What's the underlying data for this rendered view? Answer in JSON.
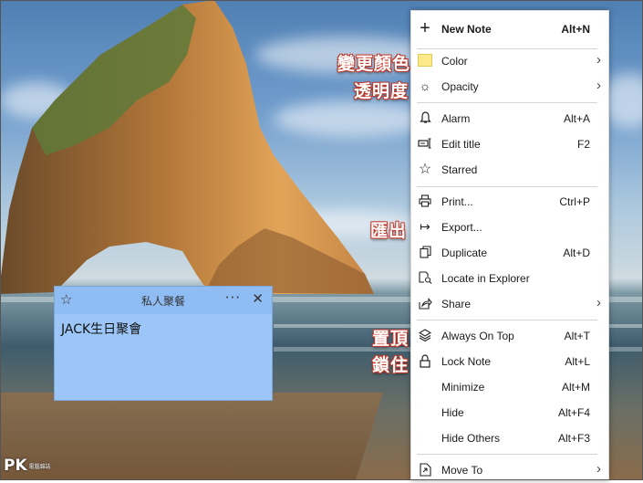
{
  "note": {
    "title": "私人聚餐",
    "body": "JACK生日聚會",
    "menu_glyph": "···",
    "close_glyph": "✕",
    "star_glyph": "☆"
  },
  "annotations": {
    "color": "變更顏色",
    "opacity": "透明度",
    "export": "匯出",
    "on_top": "置頂",
    "lock": "鎖住"
  },
  "watermark": {
    "brand": "PK",
    "tagline": "電腦雜誌"
  },
  "menu": {
    "items": [
      {
        "id": "new-note",
        "label": "New Note",
        "shortcut": "Alt+N",
        "icon": "plus-icon",
        "glyph": "+"
      },
      {
        "id": "color",
        "label": "Color",
        "shortcut": "",
        "icon": "color-swatch-icon",
        "glyph": "",
        "submenu": "›"
      },
      {
        "id": "opacity",
        "label": "Opacity",
        "shortcut": "",
        "icon": "sun-icon",
        "glyph": "☼",
        "submenu": "›"
      },
      {
        "id": "alarm",
        "label": "Alarm",
        "shortcut": "Alt+A",
        "icon": "bell-icon",
        "glyph": "🔔"
      },
      {
        "id": "edit-title",
        "label": "Edit title",
        "shortcut": "F2",
        "icon": "rename-icon",
        "glyph": "✎"
      },
      {
        "id": "starred",
        "label": "Starred",
        "shortcut": "",
        "icon": "star-icon",
        "glyph": "☆"
      },
      {
        "id": "print",
        "label": "Print...",
        "shortcut": "Ctrl+P",
        "icon": "printer-icon",
        "glyph": "⎙"
      },
      {
        "id": "export",
        "label": "Export...",
        "shortcut": "",
        "icon": "export-arrow-icon",
        "glyph": "↦"
      },
      {
        "id": "duplicate",
        "label": "Duplicate",
        "shortcut": "Alt+D",
        "icon": "copy-icon",
        "glyph": "❐"
      },
      {
        "id": "locate",
        "label": "Locate in Explorer",
        "shortcut": "",
        "icon": "locate-file-icon",
        "glyph": "⌕"
      },
      {
        "id": "share",
        "label": "Share",
        "shortcut": "",
        "icon": "share-icon",
        "glyph": "⇗",
        "submenu": "›"
      },
      {
        "id": "always-on-top",
        "label": "Always On Top",
        "shortcut": "Alt+T",
        "icon": "layers-icon",
        "glyph": "◈"
      },
      {
        "id": "lock-note",
        "label": "Lock Note",
        "shortcut": "Alt+L",
        "icon": "lock-icon",
        "glyph": "🔒"
      },
      {
        "id": "minimize",
        "label": "Minimize",
        "shortcut": "Alt+M",
        "icon": "",
        "glyph": ""
      },
      {
        "id": "hide",
        "label": "Hide",
        "shortcut": "Alt+F4",
        "icon": "",
        "glyph": ""
      },
      {
        "id": "hide-others",
        "label": "Hide Others",
        "shortcut": "Alt+F3",
        "icon": "",
        "glyph": ""
      },
      {
        "id": "move-to",
        "label": "Move To",
        "shortcut": "",
        "icon": "move-file-icon",
        "glyph": "⇲",
        "submenu": "›"
      }
    ]
  }
}
